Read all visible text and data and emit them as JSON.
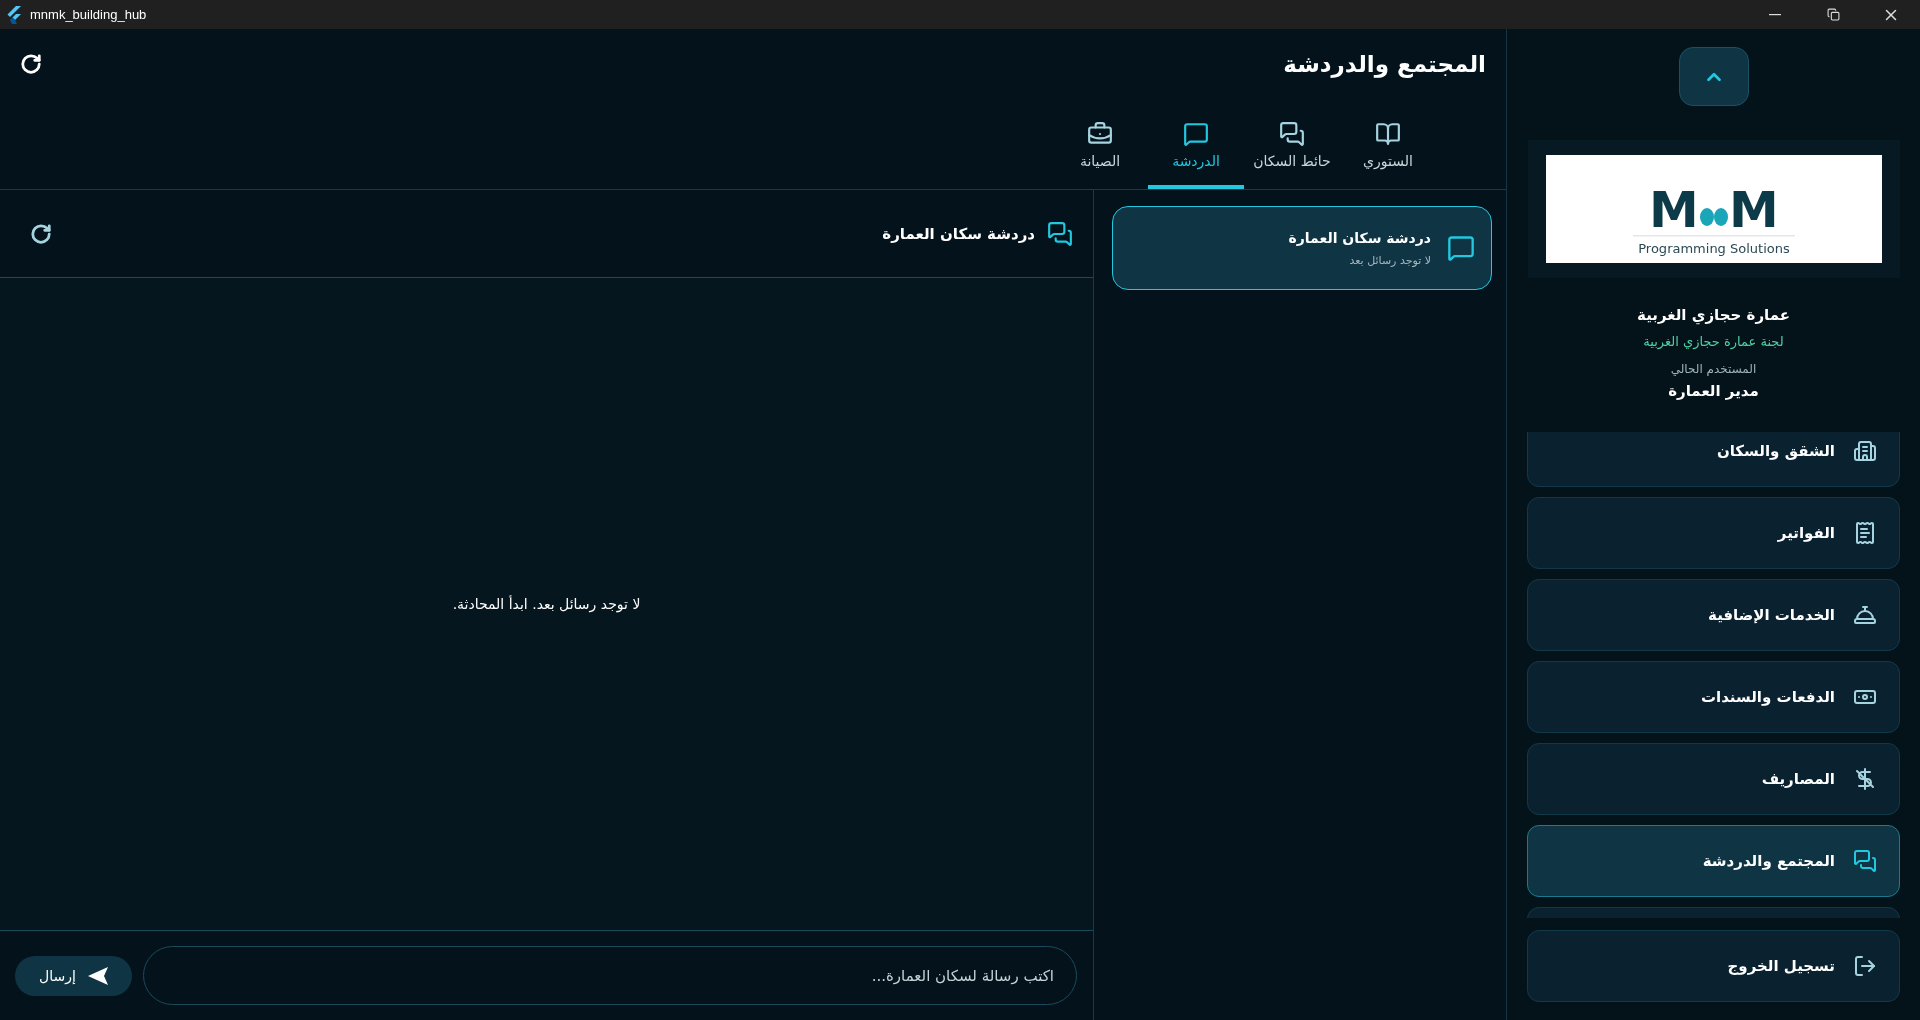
{
  "window": {
    "title": "mnmk_building_hub"
  },
  "sidebar": {
    "logo": {
      "mark_left": "M",
      "mark_right": "M",
      "tagline": "Programming Solutions"
    },
    "building_name": "عمارة حجازي الغربية",
    "committee": "لجنة عمارة حجازي الغربية",
    "user_label": "المستخدم الحالي",
    "user_role": "مدير العمارة",
    "menu": [
      {
        "label": "الشقق والسكان",
        "kind": "building",
        "selected": false
      },
      {
        "label": "الفواتير",
        "kind": "receipt",
        "selected": false
      },
      {
        "label": "الخدمات الإضافية",
        "kind": "bell",
        "selected": false
      },
      {
        "label": "الدفعات والسندات",
        "kind": "money",
        "selected": false
      },
      {
        "label": "المصاريف",
        "kind": "moneyoff",
        "selected": false
      },
      {
        "label": "المجتمع والدردشة",
        "kind": "forum",
        "selected": true
      }
    ],
    "logout": {
      "label": "تسجيل الخروج"
    }
  },
  "page": {
    "title": "المجتمع والدردشة",
    "tabs": [
      {
        "label": "الستوري",
        "kind": "book",
        "selected": false
      },
      {
        "label": "حائط السكان",
        "kind": "forum",
        "selected": false
      },
      {
        "label": "الدردشة",
        "kind": "chat",
        "selected": true
      },
      {
        "label": "الصيانة",
        "kind": "toolbox",
        "selected": false
      }
    ]
  },
  "chat_list": [
    {
      "title": "دردشة سكان العمارة",
      "subtitle": "لا توجد رسائل بعد",
      "selected": true
    }
  ],
  "chat": {
    "title": "دردشة سكان العمارة",
    "empty_message": "لا توجد رسائل بعد. ابدأ المحادثة.",
    "input_placeholder": "اكتب رسالة لسكان العمارة...",
    "send_label": "إرسال"
  }
}
